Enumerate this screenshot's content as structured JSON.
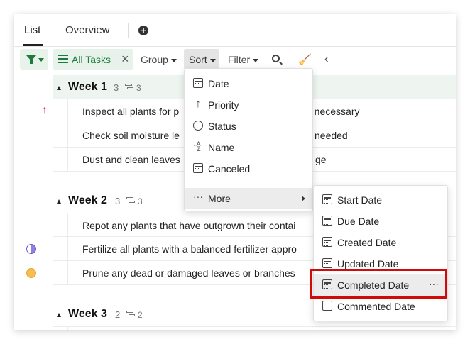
{
  "tabs": {
    "list": "List",
    "overview": "Overview",
    "add": "+"
  },
  "toolbar": {
    "all_tasks": "All Tasks",
    "close": "×",
    "group": "Group",
    "sort": "Sort",
    "filter": "Filter",
    "collapse": "‹"
  },
  "groups": [
    {
      "name": "Week 1",
      "count": "3",
      "subtasks": "3"
    },
    {
      "name": "Week 2",
      "count": "3",
      "subtasks": "3"
    },
    {
      "name": "Week 3",
      "count": "2",
      "subtasks": "2"
    }
  ],
  "rows": {
    "w1": [
      "Inspect all plants for p",
      "Check soil moisture le",
      "Dust and clean leaves"
    ],
    "w1_tail": [
      "as necessary",
      "needed",
      "ge"
    ],
    "w2": [
      "Repot any plants that have outgrown their contai",
      "Fertilize all plants with a balanced fertilizer appro",
      "Prune any dead or damaged leaves or branches"
    ]
  },
  "sort_menu": {
    "items": [
      "Date",
      "Priority",
      "Status",
      "Name",
      "Canceled"
    ],
    "more": "More"
  },
  "more_menu": {
    "items": [
      "Start Date",
      "Due Date",
      "Created Date",
      "Updated Date",
      "Completed Date",
      "Commented Date"
    ],
    "options": "···"
  },
  "colors": {
    "accent_green": "#1d7a3a",
    "highlight_red": "#d20a0a",
    "priority_red": "#e0354a"
  }
}
